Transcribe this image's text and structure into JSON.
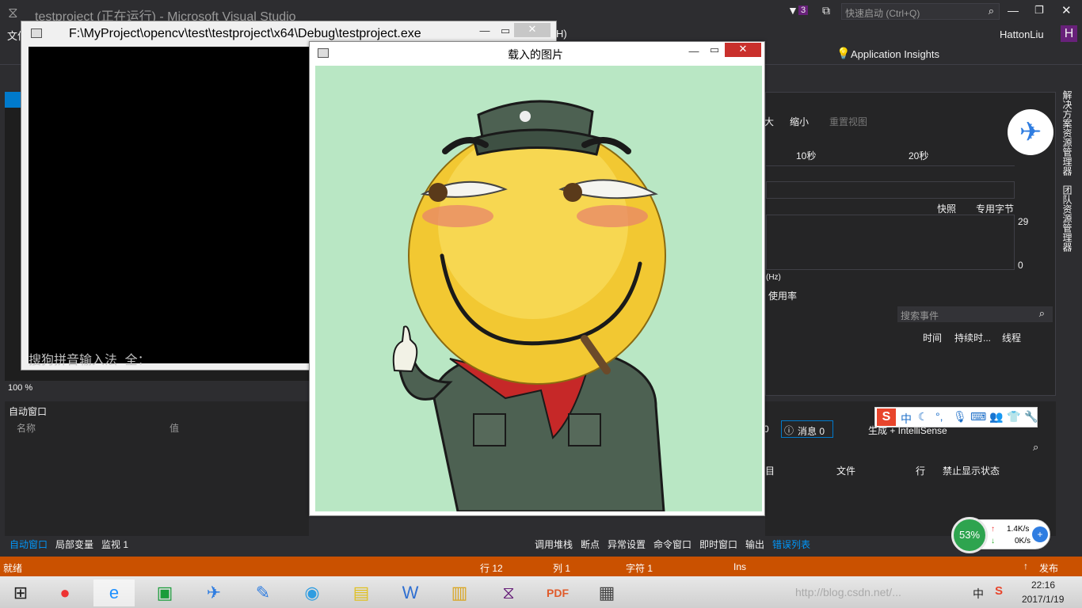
{
  "vs": {
    "title": "testproject (正在运行) - Microsoft Visual Studio",
    "notification_count": "3",
    "quick_launch_placeholder": "快速启动 (Ctrl+Q)",
    "user": "HattonLiu",
    "user_initial": "H",
    "menu_partial_left": "文件",
    "menu_partial_right": "H)",
    "app_insights": "Application Insights",
    "zoom": "100 %"
  },
  "console": {
    "title": "F:\\MyProject\\opencv\\test\\testproject\\x64\\Debug\\testproject.exe",
    "ime_text": "搜狗拼音输入法 全："
  },
  "image_window": {
    "title": "载入的图片"
  },
  "diagnostics": {
    "zoom_in_partial": "大",
    "zoom_out": "缩小",
    "reset_view": "重置视图",
    "tick_10": "10秒",
    "tick_20": "20秒",
    "legend_snapshot": "快照",
    "legend_private_bytes": "专用字节",
    "y_top": "29",
    "y_bottom": "0",
    "hz_partial": "(Hz)",
    "usage": "使用率",
    "search_events_placeholder": "搜索事件",
    "columns": [
      "时间",
      "持续时...",
      "线程"
    ]
  },
  "side_tabs": [
    "解决方案资源管理器",
    "团队资源管理器"
  ],
  "autos": {
    "title": "自动窗口",
    "col_name": "名称",
    "col_value": "值",
    "bottom_tabs": [
      "自动窗口",
      "局部变量",
      "监视 1"
    ]
  },
  "errors": {
    "messages": "消息 0",
    "left_partial": "0",
    "build_filter": "生成 + IntelliSense",
    "columns": [
      "目",
      "文件",
      "行",
      "禁止显示状态"
    ],
    "bottom_tabs": [
      "调用堆栈",
      "断点",
      "异常设置",
      "命令窗口",
      "即时窗口",
      "输出",
      "错误列表"
    ]
  },
  "sogou": {
    "lang": "中",
    "net_percent": "53%",
    "up_speed": "1.4K/s",
    "down_speed": "0K/s"
  },
  "statusbar": {
    "ready": "就绪",
    "line": "行 12",
    "col": "列 1",
    "char": "字符 1",
    "ins": "Ins",
    "publish": "发布"
  },
  "taskbar": {
    "time": "22:16",
    "date": "2017/1/19",
    "ime_lang": "中",
    "watermark": "http://blog.csdn.net/..."
  },
  "colors": {
    "vs_bg": "#2d2d30",
    "status_orange": "#ca5100",
    "image_bg": "#b9e7c4",
    "close_red": "#c9302c",
    "accent_blue": "#007acc"
  }
}
